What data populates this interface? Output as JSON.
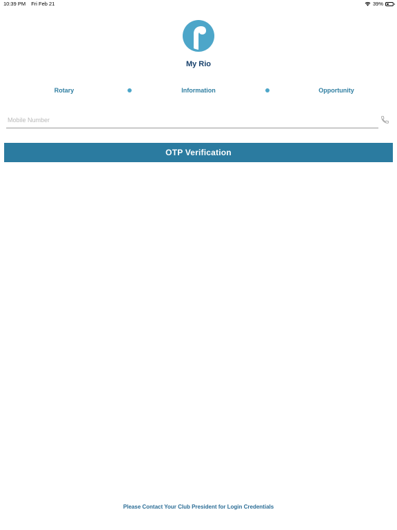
{
  "status_bar": {
    "time": "10:39 PM",
    "date": "Fri Feb 21",
    "battery_percent_label": "39%",
    "battery_level": 0.39,
    "wifi_icon": "wifi-icon"
  },
  "app": {
    "logo_icon": "rio-logo",
    "title": "My Rio",
    "brand_color": "#4da6c9",
    "title_color": "#17406b"
  },
  "steps": {
    "items": [
      {
        "label": "Rotary"
      },
      {
        "label": "Information"
      },
      {
        "label": "Opportunity"
      }
    ],
    "color": "#2f7ea1"
  },
  "mobile": {
    "placeholder": "Mobile Number",
    "value": "",
    "icon": "phone-icon"
  },
  "otp_button": {
    "label": "OTP Verification",
    "color": "#2b7ba0"
  },
  "footer": {
    "text": "Please Contact Your Club President for Login Credentials"
  }
}
